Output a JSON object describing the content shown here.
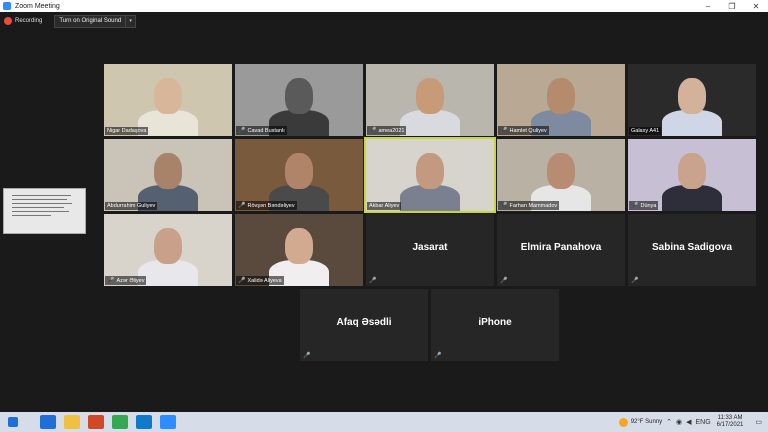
{
  "window": {
    "title": "Zoom Meeting",
    "minimize": "–",
    "maximize": "❐",
    "close": "✕"
  },
  "recording": {
    "label": "Recording"
  },
  "sound": {
    "button_label": "Turn on Original Sound",
    "dropdown": "▾"
  },
  "participants": [
    {
      "name": "Nigar Dadaşova",
      "muted": false,
      "video": true,
      "scene": "#cfc6b0",
      "skin": "#d8b69a",
      "shirt": "#e8e4d8"
    },
    {
      "name": "Cavad Bustanlı",
      "muted": true,
      "video": true,
      "scene": "#9a9a9a",
      "skin": "#5a5a5a",
      "shirt": "#3a3a3a"
    },
    {
      "name": "amea2021",
      "muted": true,
      "video": true,
      "scene": "#b9b6ae",
      "skin": "#c79a78",
      "shirt": "#d9d9e0"
    },
    {
      "name": "Hamlet Quliyev",
      "muted": true,
      "video": true,
      "scene": "#b8a894",
      "skin": "#b58b6e",
      "shirt": "#7d8aa0"
    },
    {
      "name": "Galaxy A41",
      "muted": false,
      "video": true,
      "scene": "#2a2a2a",
      "skin": "#d3b19a",
      "shirt": "#cfd6e6"
    },
    {
      "name": "Abdurrahim Guliyev",
      "muted": false,
      "video": true,
      "scene": "#c9c4b7",
      "skin": "#a8836a",
      "shirt": "#556070"
    },
    {
      "name": "Rövşən Bəndəliyev",
      "muted": true,
      "video": true,
      "scene": "#7a5a3c",
      "skin": "#b08468",
      "shirt": "#4a4a4a"
    },
    {
      "name": "Akbar Aliyev",
      "muted": false,
      "video": true,
      "scene": "#d6d4cc",
      "skin": "#c39a80",
      "shirt": "#7a8090"
    },
    {
      "name": "Farhan Mammadov",
      "muted": true,
      "video": true,
      "scene": "#b9b1a3",
      "skin": "#b88c72",
      "shirt": "#e6e6e6"
    },
    {
      "name": "Dünya",
      "muted": true,
      "video": true,
      "scene": "#c7bfd3",
      "skin": "#caa38c",
      "shirt": "#2e2e3a"
    },
    {
      "name": "Azər Əliyev",
      "muted": true,
      "video": true,
      "scene": "#d8d4cc",
      "skin": "#c9a08a",
      "shirt": "#e8e8ec"
    },
    {
      "name": "Xalidə Aliyeva",
      "muted": true,
      "video": true,
      "scene": "#5a4a3e",
      "skin": "#d2aa90",
      "shirt": "#f0eeee"
    },
    {
      "name": "Jasarat",
      "muted": true,
      "video": false
    },
    {
      "name": "Elmira Panahova",
      "muted": true,
      "video": false
    },
    {
      "name": "Sabina Sadigova",
      "muted": true,
      "video": false
    },
    {
      "name": "Afaq Əsədli",
      "muted": true,
      "video": false
    },
    {
      "name": "iPhone",
      "muted": true,
      "video": false
    }
  ],
  "taskbar": {
    "weather": "92°F  Sunny",
    "lang": "ENG",
    "time": "11:33 AM",
    "date": "6/17/2021",
    "apps": [
      "#1f6fd6",
      "#f0c040",
      "#d24726",
      "#34a853",
      "#0f7ac9",
      "#2d8cff"
    ]
  }
}
